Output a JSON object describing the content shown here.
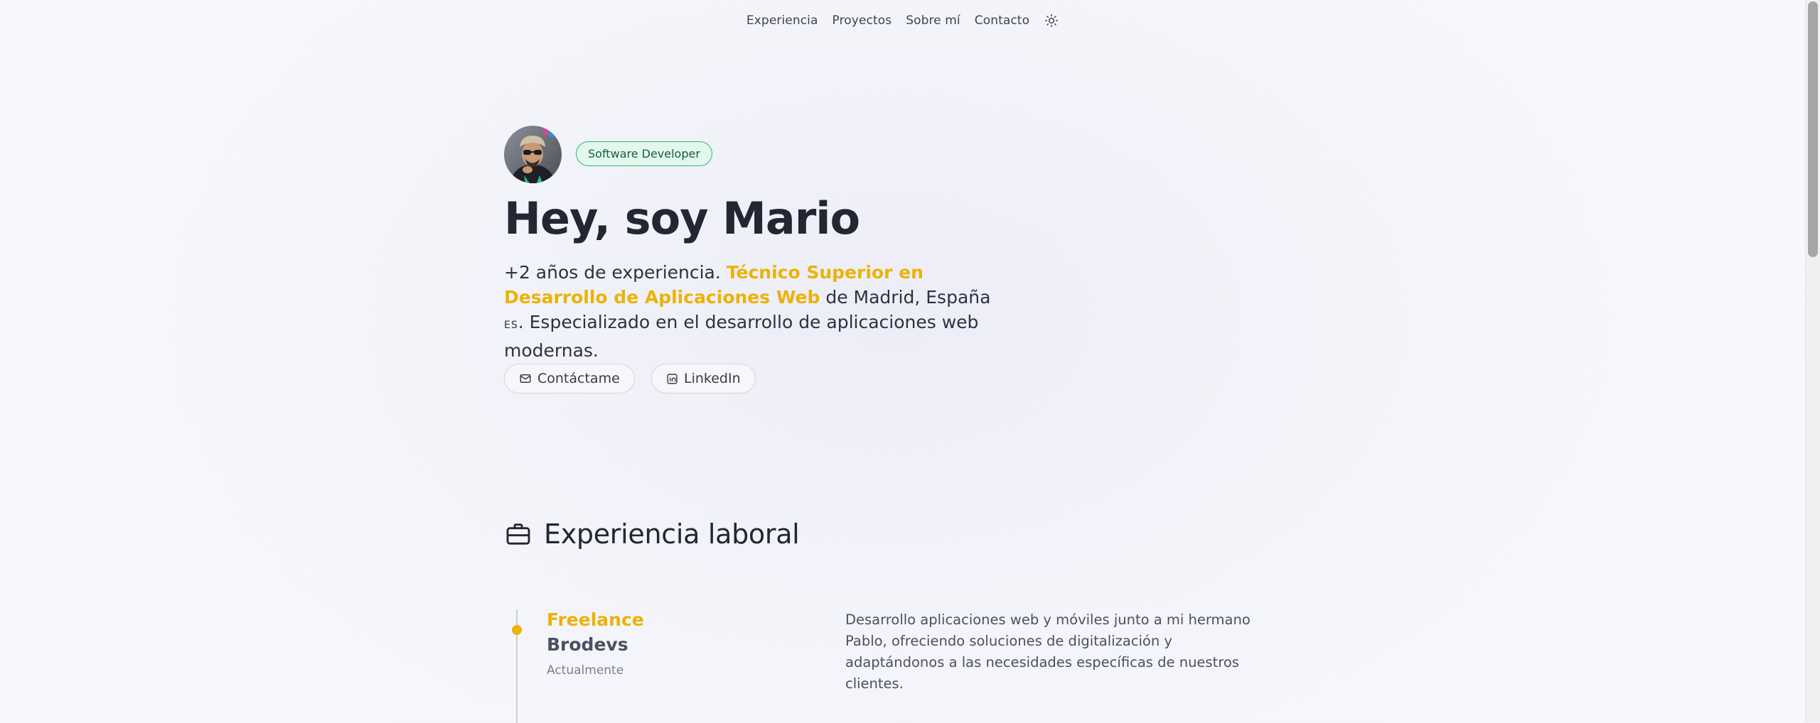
{
  "nav": {
    "items": [
      {
        "label": "Experiencia"
      },
      {
        "label": "Proyectos"
      },
      {
        "label": "Sobre mí"
      },
      {
        "label": "Contacto"
      }
    ],
    "theme_icon": "sun-icon"
  },
  "hero": {
    "avatar_icon": "avatar-photo",
    "badge": "Software Developer",
    "title": "Hey, soy Mario",
    "intro_part1": "+2 años de experiencia. ",
    "intro_highlight": "Técnico Superior en Desarrollo de Aplicaciones Web",
    "intro_part2": " de Madrid, España ",
    "intro_flag": "ES",
    "intro_part3": ". Especializado en el desarrollo de aplicaciones web modernas.",
    "buttons": {
      "contact": {
        "label": "Contáctame",
        "icon": "mail-icon"
      },
      "linkedin": {
        "label": "LinkedIn",
        "icon": "linkedin-icon"
      }
    }
  },
  "experience": {
    "title": "Experiencia laboral",
    "icon": "briefcase-icon",
    "jobs": [
      {
        "role": "Freelance",
        "company": "Brodevs",
        "date": "Actualmente",
        "description": "Desarrollo aplicaciones web y móviles junto a mi hermano Pablo, ofreciendo soluciones de digitalización y adaptándonos a las necesidades específicas de nuestros clientes."
      }
    ]
  },
  "colors": {
    "accent": "#eab308",
    "badge_bg": "#e1f8ec",
    "badge_border": "#34b37a",
    "text": "#232733"
  }
}
